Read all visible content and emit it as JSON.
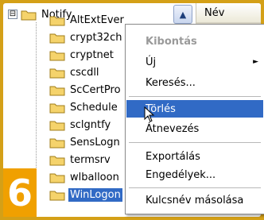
{
  "tree": {
    "parent": {
      "label": "Notify",
      "expander": "⊟"
    },
    "children": [
      {
        "label": "AltExtEver"
      },
      {
        "label": "crypt32ch"
      },
      {
        "label": "cryptnet"
      },
      {
        "label": "cscdll"
      },
      {
        "label": "ScCertPro"
      },
      {
        "label": "Schedule"
      },
      {
        "label": "sclgntfy"
      },
      {
        "label": "SensLogn"
      },
      {
        "label": "termsrv"
      },
      {
        "label": "wlballoon"
      },
      {
        "label": "WinLogon"
      }
    ]
  },
  "list_header": {
    "name_column": "Név"
  },
  "scroll_up_glyph": "▲",
  "context_menu": {
    "items": [
      {
        "label": "Kibontás",
        "state": "disabled"
      },
      {
        "label": "Új",
        "submenu": "►"
      },
      {
        "label": "Keresés..."
      },
      {
        "label": "Törlés",
        "state": "highlighted"
      },
      {
        "label": "Átnevezés"
      },
      {
        "label": "Exportálás"
      },
      {
        "label": "Engedélyek..."
      },
      {
        "label": "Kulcsnév másolása"
      }
    ]
  },
  "step_badge": {
    "number": "6"
  },
  "colors": {
    "background_border": "#d4a017",
    "badge": "#f0a000",
    "selection": "#316ac5",
    "folder": "#f5d36b"
  },
  "icons": {
    "folder": "folder-icon",
    "cursor": "mouse-cursor-icon"
  }
}
